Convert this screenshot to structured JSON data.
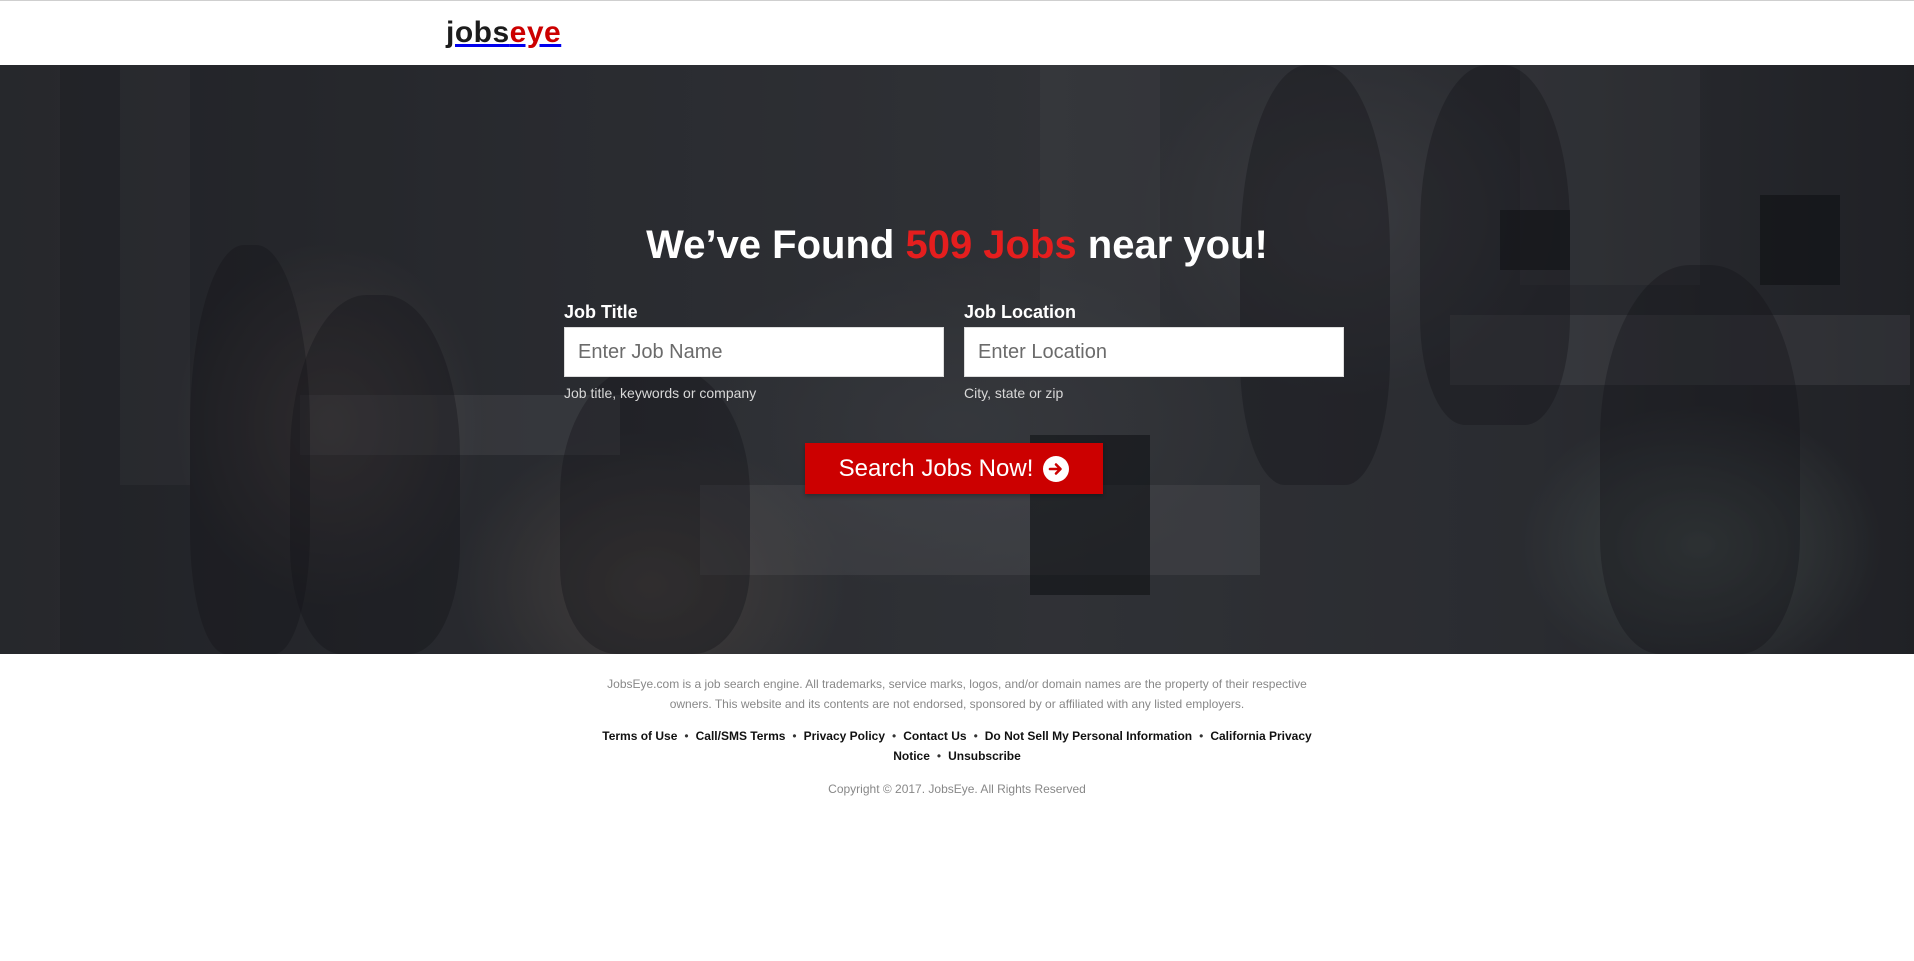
{
  "header": {
    "logo_part1": "jobs",
    "logo_part2": "eye"
  },
  "hero": {
    "headline_prefix": "We’ve Found ",
    "headline_highlight": "509 Jobs",
    "headline_suffix": " near you!",
    "job_title": {
      "label": "Job Title",
      "placeholder": "Enter Job Name",
      "value": "",
      "hint": "Job title, keywords or company"
    },
    "job_location": {
      "label": "Job Location",
      "placeholder": "Enter Location",
      "value": "",
      "hint": "City, state or zip"
    },
    "search_button_label": "Search Jobs Now!",
    "search_button_icon": "arrow-circle-right-icon"
  },
  "footer": {
    "disclaimer": "JobsEye.com is a job search engine. All trademarks, service marks, logos, and/or domain names are the property of their respective owners. This website and its contents are not endorsed, sponsored by or affiliated with any listed employers.",
    "links": {
      "terms": "Terms of Use",
      "sms": "Call/SMS Terms",
      "privacy": "Privacy Policy",
      "contact": "Contact Us",
      "do_not_sell": "Do Not Sell My Personal Information",
      "california": "California Privacy Notice",
      "unsubscribe": "Unsubscribe"
    },
    "separator": "•",
    "copyright": "Copyright © 2017. JobsEye. All Rights Reserved"
  },
  "colors": {
    "brand_red": "#cc0000",
    "highlight_red": "#e51e1e",
    "logo_dark": "#1c1c1c"
  }
}
